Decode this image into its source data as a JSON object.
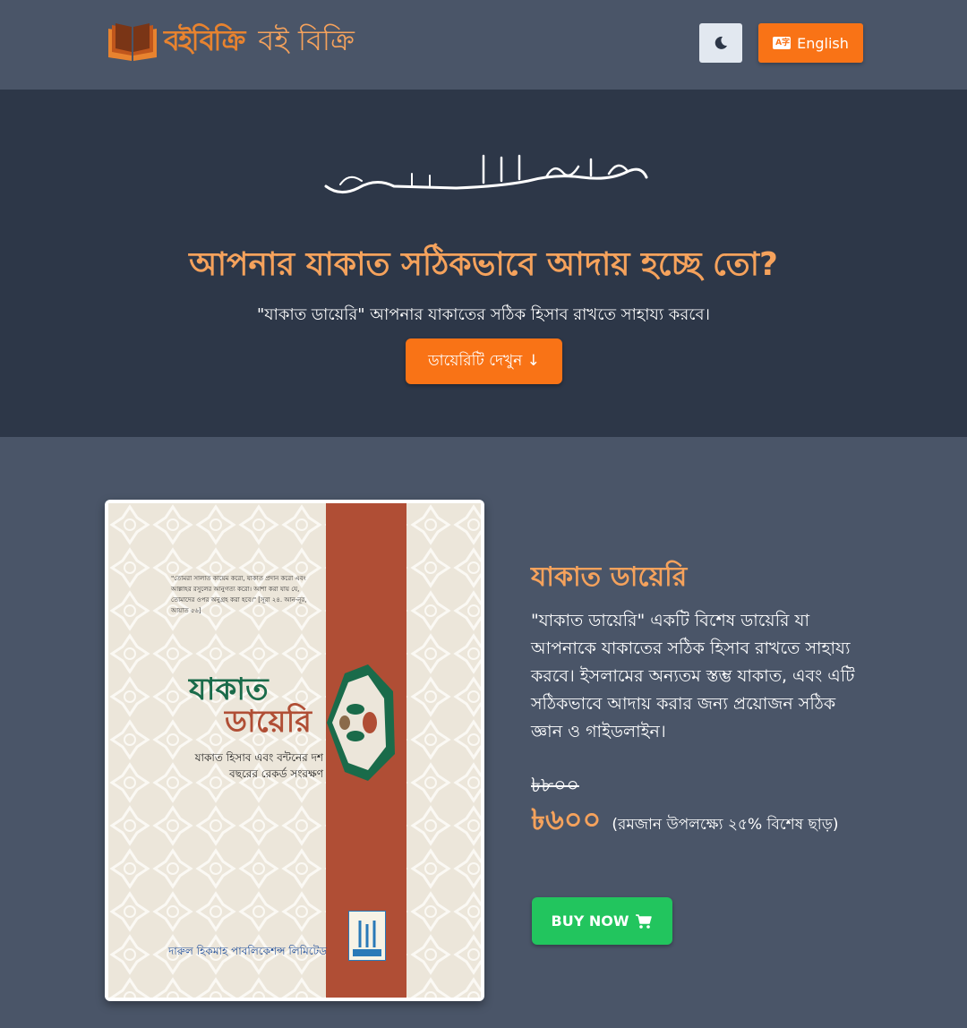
{
  "header": {
    "logo_script": "বইবিক্রি",
    "logo_text": "বই বিক্রি",
    "theme_icon": "moon-icon",
    "lang_label": "English",
    "lang_icon": "translate-icon"
  },
  "hero": {
    "bismillah": "بِسْمِ اللَّهِ الرَّحْمَنِ الرَّحِيمِ",
    "title": "আপনার যাকাত সঠিকভাবে আদায় হচ্ছে তো?",
    "subtitle": "\"যাকাত ডায়েরি\" আপনার যাকাতের সঠিক হিসাব রাখতে সাহায্য করবে।",
    "button_label": "ডায়েরিটি দেখুন ↓"
  },
  "cover": {
    "quote": "\"তোমরা সালাত কায়েম করো, যাকাত প্রদান করো এবং আল্লাহর রসুলের আনুগত্য করো। আশা করা যায় যে, তোমাদের ওপর অনুগ্রহ করা হবে।\" [সূরা ২৪. আন-নূর, আয়াত ৫৬]",
    "title_line1": "যাকাত",
    "title_line2": "ডায়েরি",
    "subtitle": "যাকাত হিসাব এবং বন্টনের দশ বছরের রেকর্ড সংরক্ষণ",
    "publisher": "দারুল হিকমাহ পাবলিকেশন্স লিমিটেড"
  },
  "product": {
    "title": "যাকাত ডায়েরি",
    "description": "\"যাকাত ডায়েরি\" একটি বিশেষ ডায়েরি যা আপনাকে যাকাতের সঠিক হিসাব রাখতে সাহায্য করবে। ইসলামের অন্যতম স্তম্ভ যাকাত, এবং এটি সঠিকভাবে আদায় করার জন্য প্রয়োজন সঠিক জ্ঞান ও গাইডলাইন।",
    "old_price": "৳৮০০",
    "new_price": "৳৬০০",
    "discount_note": "(রমজান উপলক্ষ্যে ২৫% বিশেষ ছাড়)",
    "buy_label": "BUY NOW",
    "cart_icon": "cart-icon"
  },
  "colors": {
    "accent": "#f97316",
    "title_orange": "#f5a25c",
    "buy_green": "#22c55e",
    "hero_bg": "#2d3748",
    "page_bg": "#4a5568"
  }
}
